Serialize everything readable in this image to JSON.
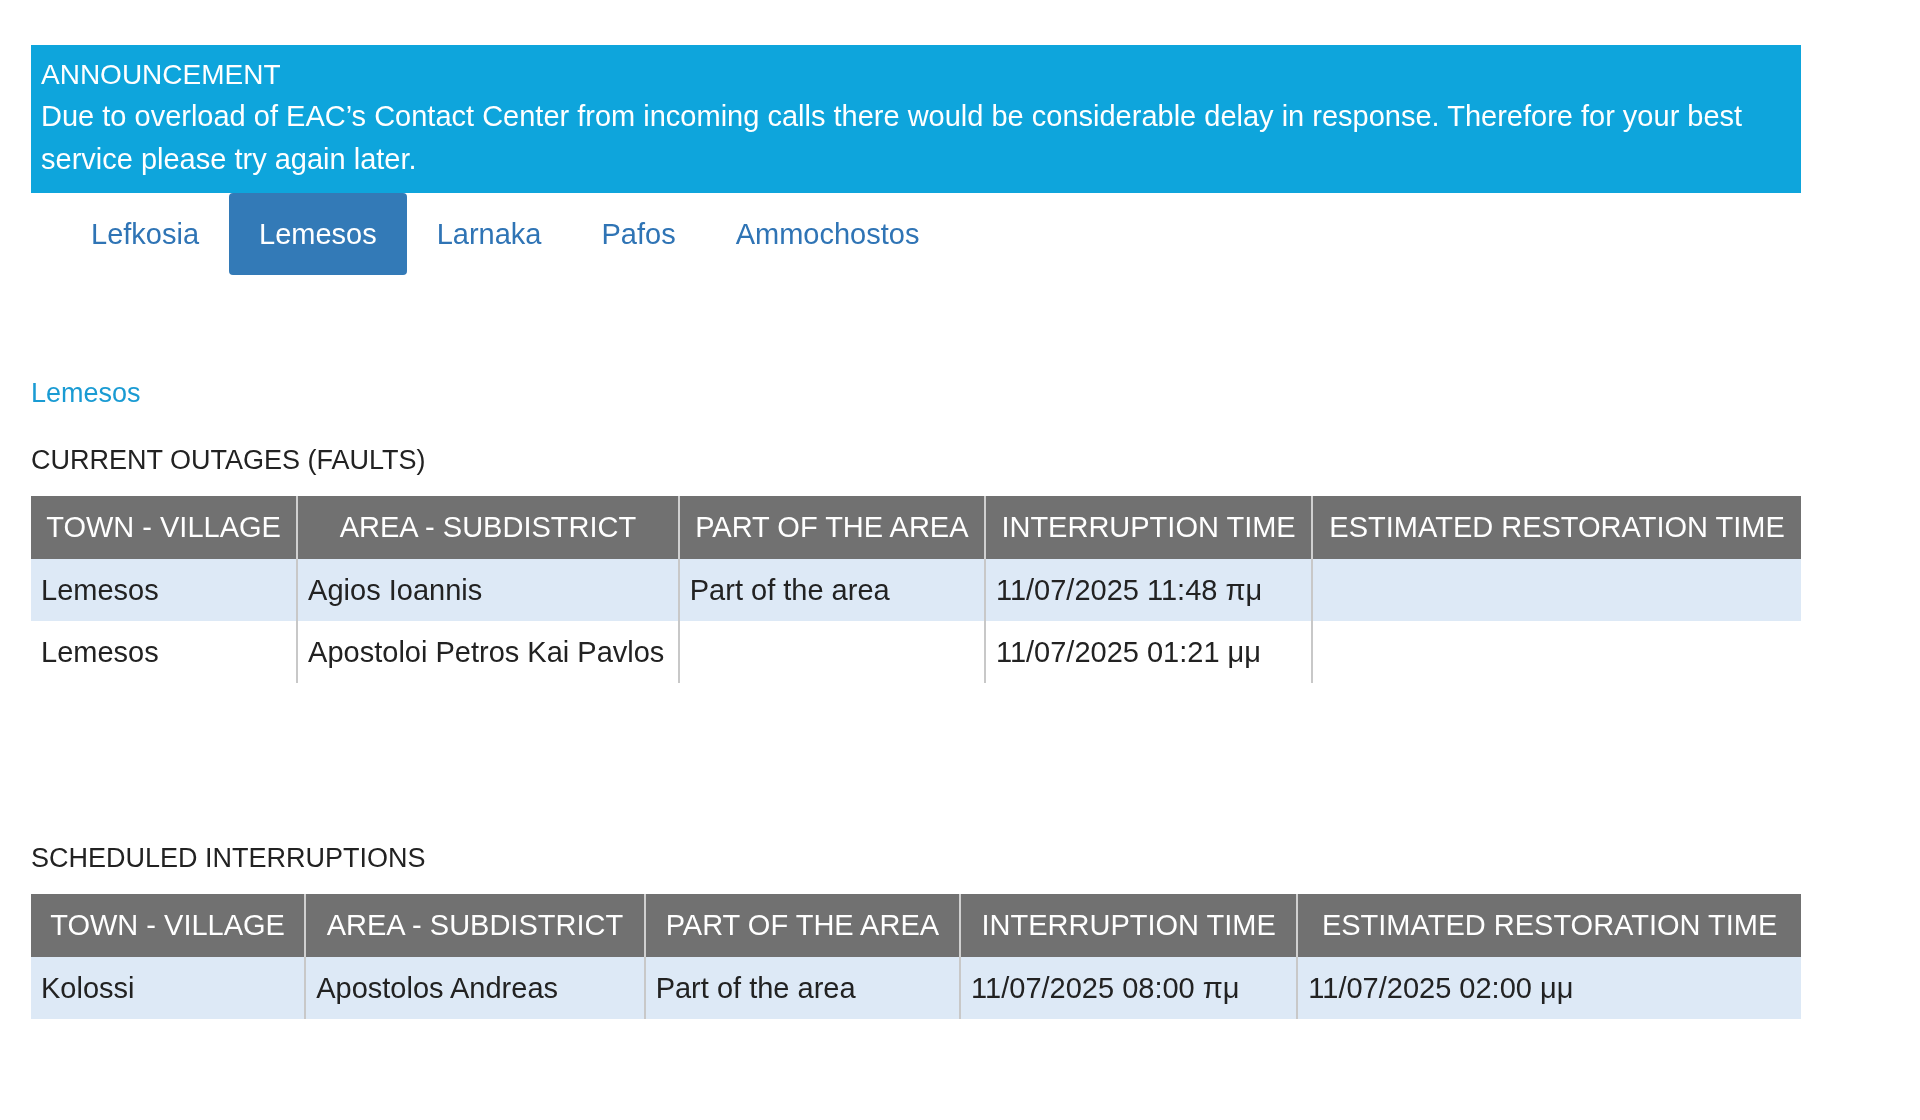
{
  "announcement": {
    "title": "ANNOUNCEMENT",
    "text": "Due to overload of EAC’s Contact Center from incoming calls there would be considerable delay in response. Therefore for your best service please try again later."
  },
  "tabs": [
    {
      "label": "Lefkosia",
      "selected": false
    },
    {
      "label": "Lemesos",
      "selected": true
    },
    {
      "label": "Larnaka",
      "selected": false
    },
    {
      "label": "Pafos",
      "selected": false
    },
    {
      "label": "Ammochostos",
      "selected": false
    }
  ],
  "region_title": "Lemesos",
  "sections": [
    {
      "heading": "CURRENT OUTAGES (FAULTS)",
      "columns": [
        "TOWN - VILLAGE",
        "AREA - SUBDISTRICT",
        "PART OF THE AREA",
        "INTERRUPTION TIME",
        "ESTIMATED RESTORATION TIME"
      ],
      "rows": [
        [
          "Lemesos",
          "Agios Ioannis",
          "Part of the area",
          "11/07/2025 11:48 πμ",
          ""
        ],
        [
          "Lemesos",
          "Apostoloi Petros Kai Pavlos",
          "",
          "11/07/2025 01:21 μμ",
          ""
        ]
      ]
    },
    {
      "heading": "SCHEDULED INTERRUPTIONS",
      "columns": [
        "TOWN - VILLAGE",
        "AREA - SUBDISTRICT",
        "PART OF THE AREA",
        "INTERRUPTION TIME",
        "ESTIMATED RESTORATION TIME"
      ],
      "rows": [
        [
          "Kolossi",
          "Apostolos Andreas",
          "Part of the area",
          "11/07/2025 08:00 πμ",
          "11/07/2025 02:00 μμ"
        ]
      ]
    }
  ]
}
